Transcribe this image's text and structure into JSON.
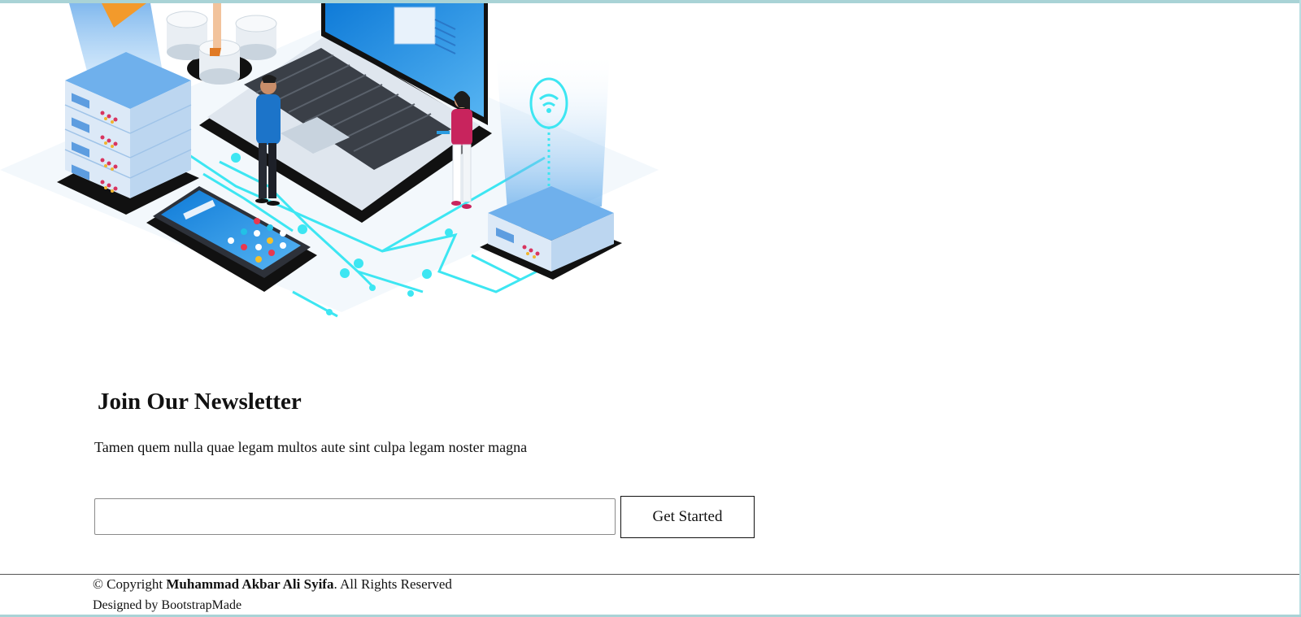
{
  "newsletter": {
    "title": "Join Our Newsletter",
    "description": "Tamen quem nulla quae legam multos aute sint culpa legam noster magna",
    "email_value": "",
    "submit_label": "Get Started"
  },
  "footer": {
    "copyright_prefix": "© Copyright ",
    "copyright_owner": "Muhammad Akbar Ali Syifa",
    "copyright_suffix": ". All Rights Reserved",
    "designed_by": "Designed by BootstrapMade"
  },
  "colors": {
    "frame": "#a9d3d6",
    "circuit": "#3de6f2",
    "screen_blue": "#1a8fe3",
    "server_face": "#cfe3f7"
  }
}
